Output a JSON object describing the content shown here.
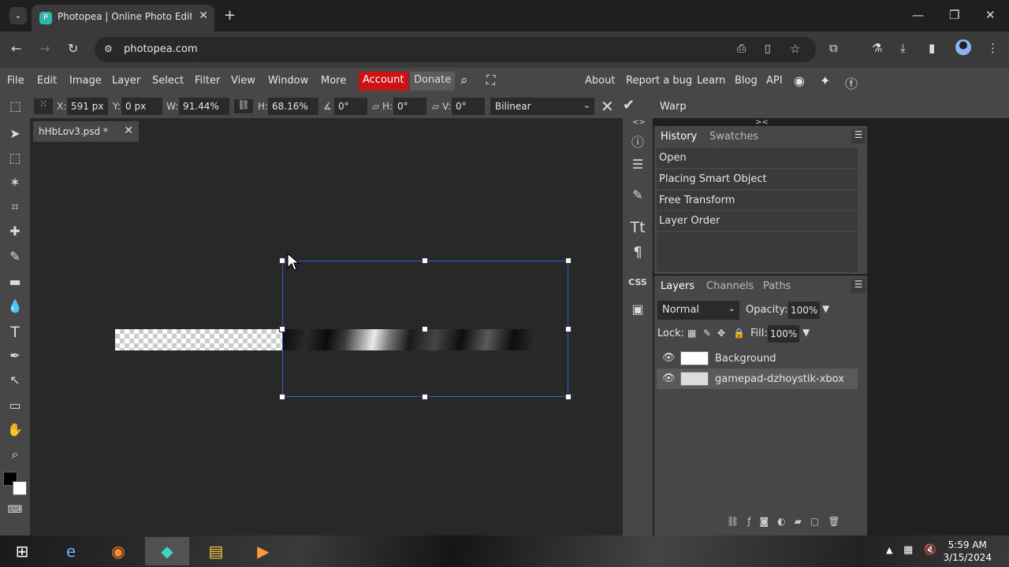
{
  "browser": {
    "tab_title": "Photopea | Online Photo Editor",
    "url": "photopea.com"
  },
  "menubar": {
    "items": [
      "File",
      "Edit",
      "Image",
      "Layer",
      "Select",
      "Filter",
      "View",
      "Window",
      "More"
    ],
    "account": "Account",
    "donate": "Donate",
    "right_items": [
      "About",
      "Report a bug",
      "Learn",
      "Blog",
      "API"
    ]
  },
  "options": {
    "x_label": "X:",
    "x_value": "591 px",
    "y_label": "Y:",
    "y_value": "0 px",
    "w_label": "W:",
    "w_value": "91.44%",
    "h_label": "H:",
    "h_value": "68.16%",
    "angle_value": "0°",
    "skew_h_label": "H:",
    "skew_h_value": "0°",
    "skew_v_label": "V:",
    "skew_v_value": "0°",
    "interpolation": "Bilinear",
    "warp": "Warp"
  },
  "document": {
    "tab": "hHbLov3.psd *"
  },
  "history": {
    "tab_active": "History",
    "tab_other": "Swatches",
    "items": [
      "Open",
      "Placing Smart Object",
      "Free Transform",
      "Layer Order"
    ]
  },
  "layers": {
    "tabs": [
      "Layers",
      "Channels",
      "Paths"
    ],
    "blend_mode": "Normal",
    "opacity_label": "Opacity:",
    "opacity_value": "100%",
    "lock_label": "Lock:",
    "fill_label": "Fill:",
    "fill_value": "100%",
    "rows": [
      "Background",
      "gamepad-dzhoystik-xbox"
    ]
  },
  "taskbar": {
    "time": "5:59 AM",
    "date": "3/15/2024"
  }
}
